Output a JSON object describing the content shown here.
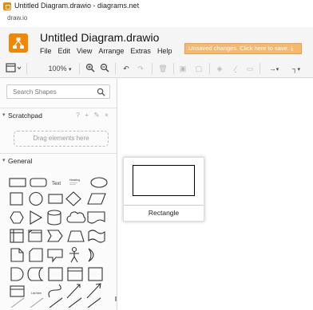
{
  "browser": {
    "title": "Untitled Diagram.drawio - diagrams.net",
    "url": "draw.io"
  },
  "app": {
    "doc_title": "Untitled Diagram.drawio",
    "menu": [
      "File",
      "Edit",
      "View",
      "Arrange",
      "Extras",
      "Help"
    ],
    "unsaved_notice": "Unsaved changes. Click here to save.",
    "accent": "#f08705",
    "notice_color": "#f4b870"
  },
  "toolbar": {
    "zoom": "100%"
  },
  "sidebar": {
    "search_placeholder": "Search Shapes",
    "scratchpad_label": "Scratchpad",
    "scratchpad_tools": "? + ✎ ×",
    "drag_hint": "Drag elements here",
    "general_label": "General",
    "text_shape_label": "Text",
    "heading_shape_label": "Heading",
    "list_item_label": "List Item"
  },
  "canvas": {
    "hover_shape_caption": "Rectangle"
  }
}
